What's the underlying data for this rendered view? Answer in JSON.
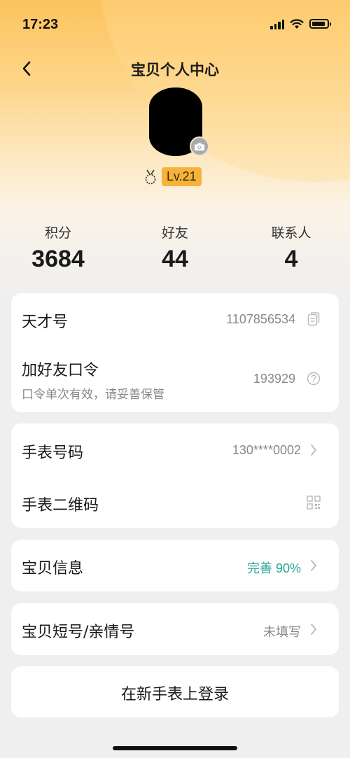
{
  "status_bar": {
    "time": "17:23"
  },
  "header": {
    "title": "宝贝个人中心"
  },
  "profile": {
    "level": "Lv.21"
  },
  "stats": [
    {
      "label": "积分",
      "value": "3684"
    },
    {
      "label": "好友",
      "value": "44"
    },
    {
      "label": "联系人",
      "value": "4"
    }
  ],
  "account": {
    "genius_label": "天才号",
    "genius_value": "1107856534",
    "friend_code_label": "加好友口令",
    "friend_code_sub": "口令单次有效，请妥善保管",
    "friend_code_value": "193929"
  },
  "watch": {
    "number_label": "手表号码",
    "number_value": "130****0002",
    "qr_label": "手表二维码"
  },
  "baby_info": {
    "label": "宝贝信息",
    "value": "完善 90%"
  },
  "short_number": {
    "label": "宝贝短号/亲情号",
    "value": "未填写"
  },
  "login_new": {
    "label": "在新手表上登录"
  },
  "colors": {
    "accent": "#2aa59a",
    "level_badge": "#f7b23b",
    "header_gradient_top": "#fcc35c"
  }
}
